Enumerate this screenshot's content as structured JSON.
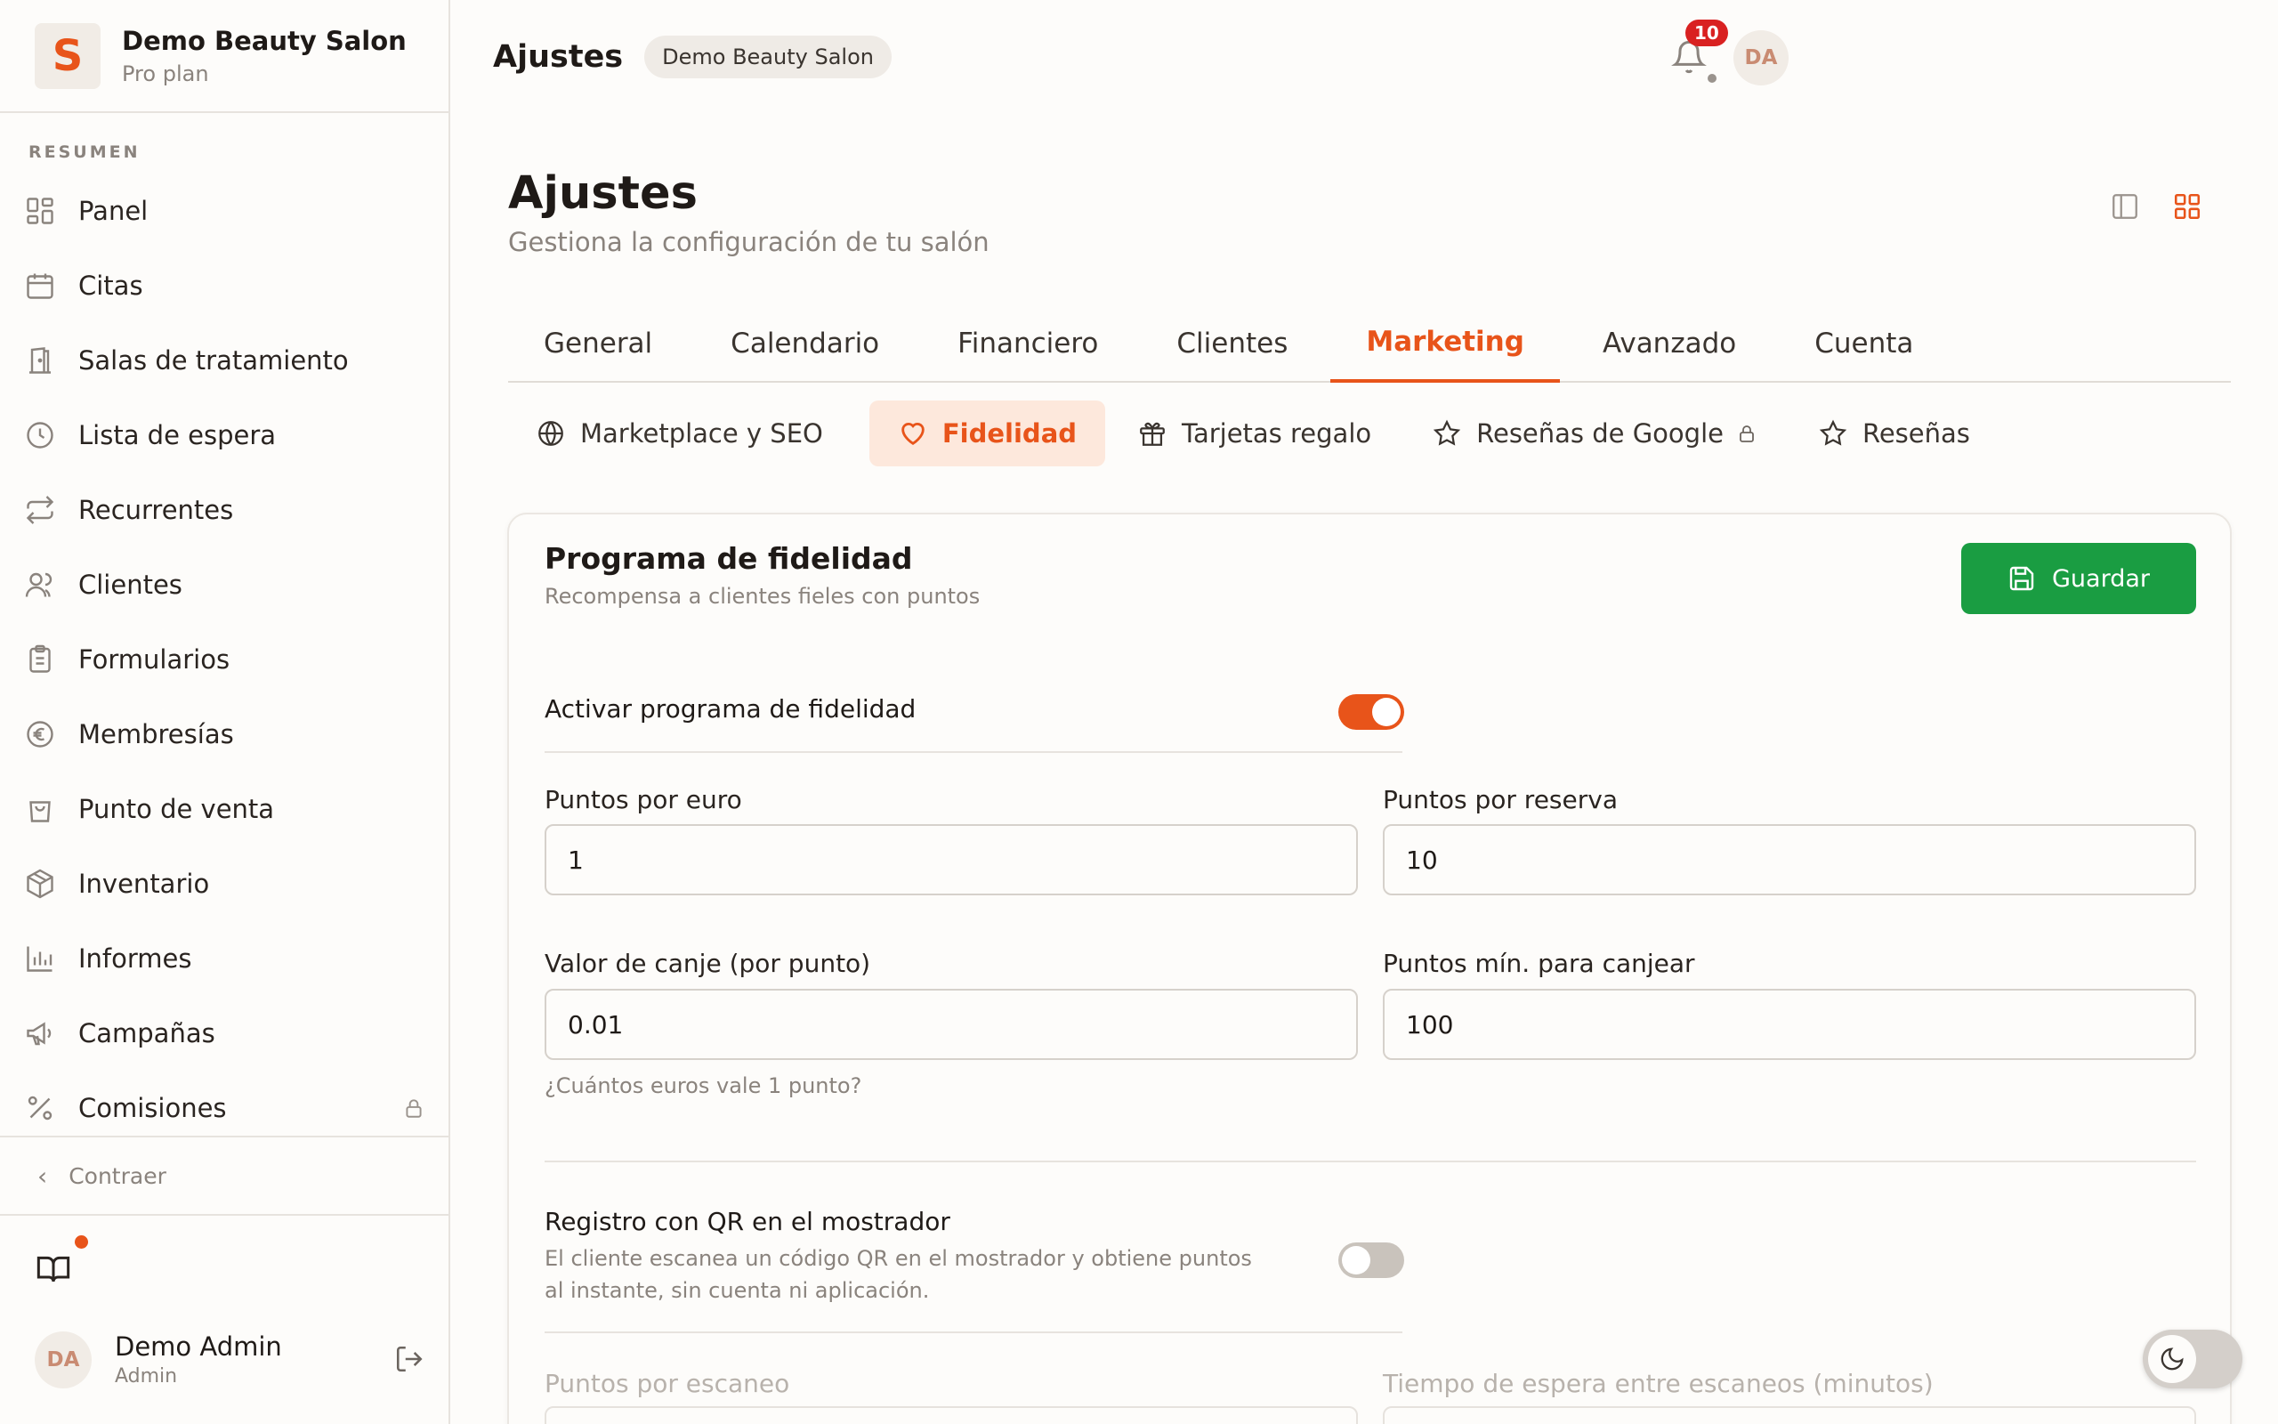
{
  "brand": {
    "logo_letter": "S",
    "name": "Demo Beauty Salon",
    "plan": "Pro plan",
    "accent": "#e8541a"
  },
  "sidebar": {
    "section_label": "RESUMEN",
    "items": [
      {
        "label": "Panel",
        "icon": "dashboard-icon"
      },
      {
        "label": "Citas",
        "icon": "calendar-icon"
      },
      {
        "label": "Salas de tratamiento",
        "icon": "door-icon"
      },
      {
        "label": "Lista de espera",
        "icon": "clock-icon"
      },
      {
        "label": "Recurrentes",
        "icon": "repeat-icon"
      },
      {
        "label": "Clientes",
        "icon": "users-icon"
      },
      {
        "label": "Formularios",
        "icon": "clipboard-icon"
      },
      {
        "label": "Membresías",
        "icon": "euro-icon"
      },
      {
        "label": "Punto de venta",
        "icon": "shopping-bag-icon"
      },
      {
        "label": "Inventario",
        "icon": "box-icon"
      },
      {
        "label": "Informes",
        "icon": "bar-chart-icon"
      },
      {
        "label": "Campañas",
        "icon": "megaphone-icon"
      },
      {
        "label": "Comisiones",
        "icon": "percent-icon",
        "locked": true
      }
    ],
    "collapse_label": "Contraer",
    "user": {
      "initials": "DA",
      "name": "Demo Admin",
      "role": "Admin"
    }
  },
  "topbar": {
    "title": "Ajustes",
    "chip": "Demo Beauty Salon",
    "notifications_count": "10",
    "avatar_initials": "DA"
  },
  "page": {
    "title": "Ajustes",
    "subtitle": "Gestiona la configuración de tu salón"
  },
  "tabs": [
    {
      "label": "General"
    },
    {
      "label": "Calendario"
    },
    {
      "label": "Financiero"
    },
    {
      "label": "Clientes"
    },
    {
      "label": "Marketing",
      "active": true
    },
    {
      "label": "Avanzado"
    },
    {
      "label": "Cuenta"
    }
  ],
  "subtabs": [
    {
      "label": "Marketplace y SEO",
      "icon": "globe-icon"
    },
    {
      "label": "Fidelidad",
      "icon": "heart-icon",
      "active": true
    },
    {
      "label": "Tarjetas regalo",
      "icon": "gift-icon"
    },
    {
      "label": "Reseñas de Google",
      "icon": "star-icon",
      "locked": true
    },
    {
      "label": "Reseñas",
      "icon": "star-icon"
    }
  ],
  "card": {
    "title": "Programa de fidelidad",
    "subtitle": "Recompensa a clientes fieles con puntos",
    "save_label": "Guardar",
    "save_color": "#1a9d42",
    "enable_label": "Activar programa de fidelidad",
    "enable_on": true,
    "fields": {
      "points_per_euro": {
        "label": "Puntos por euro",
        "value": "1"
      },
      "points_per_booking": {
        "label": "Puntos por reserva",
        "value": "10"
      },
      "redeem_value": {
        "label": "Valor de canje (por punto)",
        "value": "0.01",
        "hint": "¿Cuántos euros vale 1 punto?"
      },
      "min_points": {
        "label": "Puntos mín. para canjear",
        "value": "100"
      }
    },
    "qr": {
      "label": "Registro con QR en el mostrador",
      "description": "El cliente escanea un código QR en el mostrador y obtiene puntos al instante, sin cuenta ni aplicación.",
      "on": false,
      "points_per_scan_label": "Puntos por escaneo",
      "cooldown_label": "Tiempo de espera entre escaneos (minutos)"
    }
  }
}
